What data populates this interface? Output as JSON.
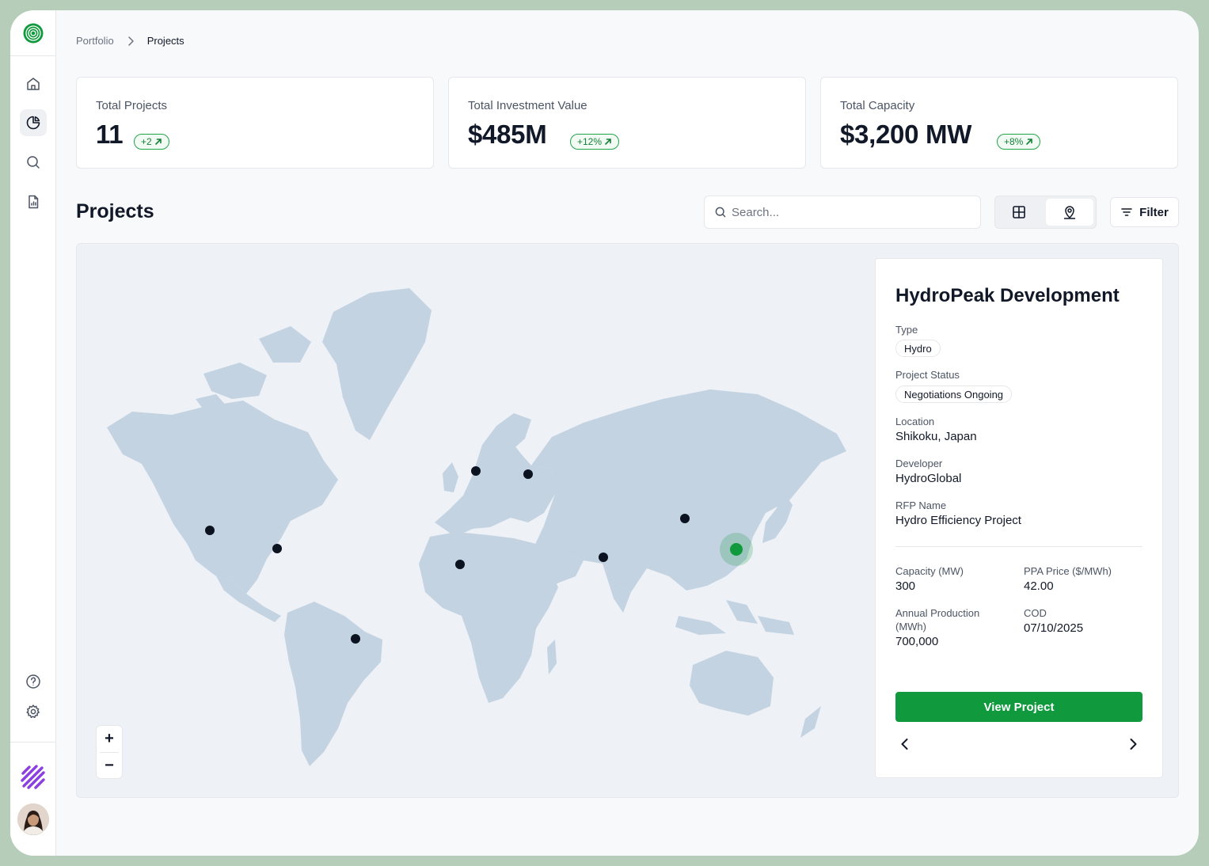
{
  "breadcrumb": {
    "parent": "Portfolio",
    "current": "Projects"
  },
  "stats": [
    {
      "label": "Total Projects",
      "value": "11",
      "change": "+2"
    },
    {
      "label": "Total Investment Value",
      "value": "$485M",
      "change": "+12%"
    },
    {
      "label": "Total Capacity",
      "value": "$3,200 MW",
      "change": "+8%"
    }
  ],
  "projects": {
    "title": "Projects",
    "search_placeholder": "Search...",
    "filter_label": "Filter",
    "view_mode": "map"
  },
  "map": {
    "zoom_in": "+",
    "zoom_out": "−"
  },
  "selected_project": {
    "name": "HydroPeak Development",
    "type_label": "Type",
    "type": "Hydro",
    "status_label": "Project Status",
    "status": "Negotiations Ongoing",
    "location_label": "Location",
    "location": "Shikoku, Japan",
    "developer_label": "Developer",
    "developer": "HydroGlobal",
    "rfp_label": "RFP Name",
    "rfp": "Hydro Efficiency Project",
    "capacity_label": "Capacity (MW)",
    "capacity": "300",
    "ppa_label": "PPA Price ($/MWh)",
    "ppa": "42.00",
    "production_label_1": "Annual Production",
    "production_label_2": "(MWh)",
    "production": "700,000",
    "cod_label": "COD",
    "cod": "07/10/2025",
    "action": "View Project"
  },
  "colors": {
    "accent": "#109a3d",
    "land": "#c3d3e2",
    "marker": "#0b1220",
    "badge": "#16803a"
  }
}
